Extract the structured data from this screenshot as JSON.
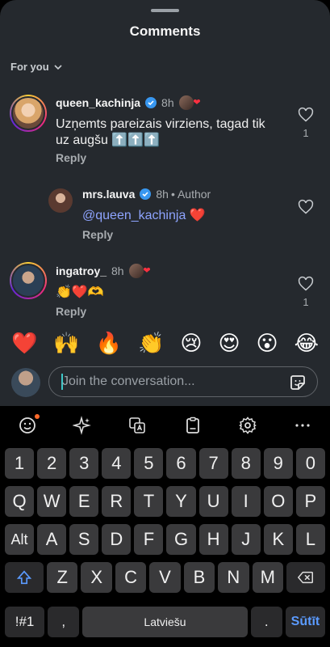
{
  "header": {
    "title": "Comments",
    "filter_label": "For you"
  },
  "comments": [
    {
      "username": "queen_kachinja",
      "time": "8h",
      "text": "Uzņemts pareizais virziens, tagad tik uz augšu ⬆️⬆️⬆️",
      "reply_label": "Reply",
      "likes": "1"
    },
    {
      "username": "mrs.lauva",
      "time": "8h",
      "author_tag": "• Author",
      "mention": "@queen_kachinja",
      "text_suffix": " ❤️",
      "reply_label": "Reply"
    },
    {
      "username": "ingatroy_",
      "time": "8h",
      "text": "👏❤️🫶",
      "reply_label": "Reply",
      "likes": "1"
    }
  ],
  "emoji_bar": [
    "❤️",
    "🙌",
    "🔥",
    "👏",
    "😢",
    "😍",
    "😮",
    "😂"
  ],
  "composer": {
    "placeholder": "Join the conversation..."
  },
  "keyboard": {
    "number_row": [
      "1",
      "2",
      "3",
      "4",
      "5",
      "6",
      "7",
      "8",
      "9",
      "0"
    ],
    "row1": [
      "Q",
      "W",
      "E",
      "R",
      "T",
      "Y",
      "U",
      "I",
      "O",
      "P"
    ],
    "row2": [
      "Alt",
      "A",
      "S",
      "D",
      "F",
      "G",
      "H",
      "J",
      "K",
      "L"
    ],
    "row3": [
      "Z",
      "X",
      "C",
      "V",
      "B",
      "N",
      "M"
    ],
    "symbols": "!#1",
    "comma": ",",
    "space": "Latviešu",
    "period": ".",
    "send": "Sūtīt"
  },
  "colors": {
    "like_heart": "#ff3040",
    "mention": "#8ea4ff",
    "send": "#5b9bff",
    "verified": "#3897f0"
  }
}
